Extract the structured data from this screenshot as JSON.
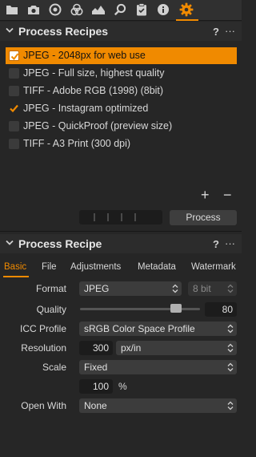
{
  "toolbar": {
    "tools": [
      "folder-icon",
      "camera-icon",
      "lens-icon",
      "color-icon",
      "exposure-icon",
      "search-icon",
      "clipboard-icon",
      "info-icon",
      "gear-icon"
    ],
    "active_tool": "gear-icon",
    "accent_color": "#f08a00"
  },
  "recipes_panel": {
    "title": "Process Recipes",
    "help": "?",
    "more": "···",
    "items": [
      {
        "label": "JPEG - 2048px for web use",
        "checked": true,
        "selected": true
      },
      {
        "label": "JPEG - Full size, highest quality",
        "checked": false,
        "selected": false
      },
      {
        "label": "TIFF - Adobe RGB (1998) (8bit)",
        "checked": false,
        "selected": false
      },
      {
        "label": "JPEG - Instagram optimized",
        "checked": true,
        "selected": false
      },
      {
        "label": "JPEG - QuickProof (preview size)",
        "checked": false,
        "selected": false
      },
      {
        "label": "TIFF - A3 Print (300 dpi)",
        "checked": false,
        "selected": false
      }
    ],
    "add_label": "+",
    "remove_label": "−",
    "process_button": "Process"
  },
  "recipe_panel": {
    "title": "Process Recipe",
    "help": "?",
    "more": "···",
    "tabs": [
      "Basic",
      "File",
      "Adjustments",
      "Metadata",
      "Watermark"
    ],
    "active_tab": "Basic",
    "format": {
      "label": "Format",
      "value": "JPEG",
      "bit_depth": "8 bit"
    },
    "quality": {
      "label": "Quality",
      "value": "80",
      "level": 0.8
    },
    "icc_profile": {
      "label": "ICC Profile",
      "value": "sRGB Color Space Profile"
    },
    "resolution": {
      "label": "Resolution",
      "value": "300",
      "unit": "px/in"
    },
    "scale": {
      "label": "Scale",
      "value": "Fixed",
      "percent": "100",
      "percent_unit": "%"
    },
    "open_with": {
      "label": "Open With",
      "value": "None"
    }
  }
}
